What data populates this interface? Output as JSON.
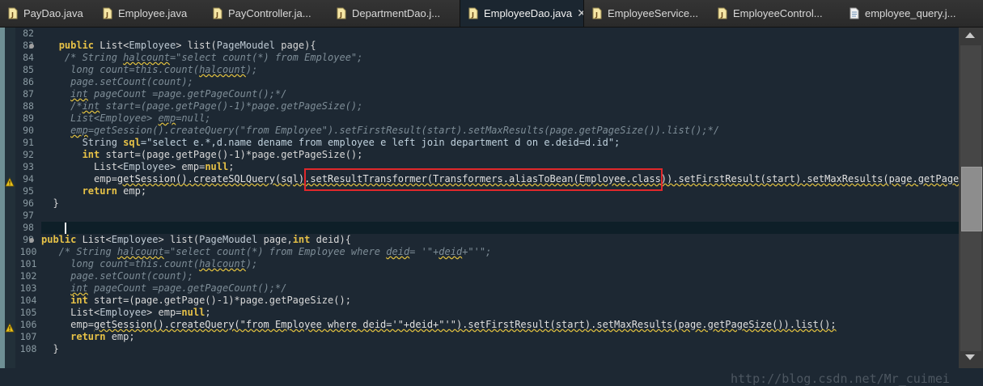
{
  "tabs": [
    {
      "label": "PayDao.java",
      "icon": "java-file-icon",
      "active": false
    },
    {
      "label": "Employee.java",
      "icon": "java-file-icon",
      "active": false
    },
    {
      "label": "PayController.ja...",
      "icon": "java-file-icon",
      "active": false
    },
    {
      "label": "DepartmentDao.j...",
      "icon": "java-file-icon",
      "active": false
    },
    {
      "label": "EmployeeDao.java",
      "icon": "java-file-icon",
      "active": true,
      "close": "✕"
    },
    {
      "label": "EmployeeService...",
      "icon": "java-file-icon",
      "active": false
    },
    {
      "label": "EmployeeControl...",
      "icon": "java-file-icon",
      "active": false
    },
    {
      "label": "employee_query.j...",
      "icon": "jsp-file-icon",
      "active": false
    }
  ],
  "editor": {
    "lines": [
      {
        "n": "82",
        "segs": [
          {
            "t": ""
          }
        ]
      },
      {
        "n": "83",
        "fold": true,
        "segs": [
          {
            "t": "   "
          },
          {
            "t": "public",
            "c": "kw"
          },
          {
            "t": " List<",
            "c": "ty"
          },
          {
            "t": "Employee",
            "c": "ct"
          },
          {
            "t": "> list(",
            "c": "ty"
          },
          {
            "t": "PageMoudel",
            "c": "ct"
          },
          {
            "t": " page){",
            "c": "ty"
          }
        ]
      },
      {
        "n": "84",
        "segs": [
          {
            "t": "    /* String ",
            "c": "cm"
          },
          {
            "t": "halcount",
            "c": "cm wv"
          },
          {
            "t": "=\"select count(*) from Employee\";",
            "c": "cm"
          }
        ]
      },
      {
        "n": "85",
        "segs": [
          {
            "t": "     long count=this.count(",
            "c": "cm"
          },
          {
            "t": "halcount",
            "c": "cm wv"
          },
          {
            "t": ");",
            "c": "cm"
          }
        ]
      },
      {
        "n": "86",
        "segs": [
          {
            "t": "     page.setCount(count);",
            "c": "cm"
          }
        ]
      },
      {
        "n": "87",
        "segs": [
          {
            "t": "     ",
            "c": "cm"
          },
          {
            "t": "int",
            "c": "cm wv"
          },
          {
            "t": " pageCount =page.getPageCount();*/",
            "c": "cm"
          }
        ]
      },
      {
        "n": "88",
        "segs": [
          {
            "t": "     /*",
            "c": "cm"
          },
          {
            "t": "int",
            "c": "cm wv"
          },
          {
            "t": " start=(page.getPage()-1)*page.getPageSize();",
            "c": "cm"
          }
        ]
      },
      {
        "n": "89",
        "segs": [
          {
            "t": "     List<Employee> ",
            "c": "cm"
          },
          {
            "t": "emp",
            "c": "cm wv"
          },
          {
            "t": "=null;",
            "c": "cm"
          }
        ]
      },
      {
        "n": "90",
        "segs": [
          {
            "t": "     ",
            "c": "cm"
          },
          {
            "t": "emp",
            "c": "cm wv"
          },
          {
            "t": "=getSession().createQuery(\"from Employee\").setFirstResult(start).setMaxResults(page.getPageSize()).list();*/",
            "c": "cm"
          }
        ]
      },
      {
        "n": "91",
        "segs": [
          {
            "t": "       "
          },
          {
            "t": "String",
            "c": "ct"
          },
          {
            "t": " "
          },
          {
            "t": "sql",
            "c": "kw"
          },
          {
            "t": "=\"select e.*,d.name dename from employee e left join department d on e.deid=d.id\";",
            "c": "str"
          }
        ]
      },
      {
        "n": "92",
        "segs": [
          {
            "t": "       "
          },
          {
            "t": "int",
            "c": "kw"
          },
          {
            "t": " start=(page.getPage()-1)*page.getPageSize();",
            "c": "ty"
          }
        ]
      },
      {
        "n": "93",
        "segs": [
          {
            "t": "         List<",
            "c": "ty"
          },
          {
            "t": "Employee",
            "c": "ct"
          },
          {
            "t": "> emp=",
            "c": "ty"
          },
          {
            "t": "null",
            "c": "kw"
          },
          {
            "t": ";",
            "c": "ty"
          }
        ]
      },
      {
        "n": "94",
        "warn": true,
        "segs": [
          {
            "t": "         emp=",
            "c": "ty"
          },
          {
            "t": "getSession().createSQLQuery(sql).setResultTransformer(Transformers.aliasToBean(Employee.class)).setFirstResult(start).setMaxResults(page.getPageSize",
            "c": "fn wv"
          }
        ]
      },
      {
        "n": "95",
        "segs": [
          {
            "t": "       "
          },
          {
            "t": "return",
            "c": "kw"
          },
          {
            "t": " emp;",
            "c": "ty"
          }
        ]
      },
      {
        "n": "96",
        "segs": [
          {
            "t": "  }",
            "c": "ty"
          }
        ]
      },
      {
        "n": "97",
        "segs": [
          {
            "t": ""
          }
        ]
      },
      {
        "n": "98",
        "segs": [
          {
            "t": ""
          }
        ]
      },
      {
        "n": "99",
        "fold": true,
        "segs": [
          {
            "t": "public",
            "c": "kw"
          },
          {
            "t": " List<",
            "c": "ty"
          },
          {
            "t": "Employee",
            "c": "ct"
          },
          {
            "t": "> list(",
            "c": "ty"
          },
          {
            "t": "PageMoudel",
            "c": "ct"
          },
          {
            "t": " page,",
            "c": "ty"
          },
          {
            "t": "int",
            "c": "kw"
          },
          {
            "t": " deid){",
            "c": "ty"
          }
        ]
      },
      {
        "n": "100",
        "segs": [
          {
            "t": "   /* String ",
            "c": "cm"
          },
          {
            "t": "halcount",
            "c": "cm wv"
          },
          {
            "t": "=\"select count(*) from Employee where ",
            "c": "cm"
          },
          {
            "t": "deid",
            "c": "cm wv"
          },
          {
            "t": "= '\"+",
            "c": "cm"
          },
          {
            "t": "deid",
            "c": "cm wv"
          },
          {
            "t": "+\"'\";",
            "c": "cm"
          }
        ]
      },
      {
        "n": "101",
        "segs": [
          {
            "t": "     long count=this.count(",
            "c": "cm"
          },
          {
            "t": "halcount",
            "c": "cm wv"
          },
          {
            "t": ");",
            "c": "cm"
          }
        ]
      },
      {
        "n": "102",
        "segs": [
          {
            "t": "     page.setCount(count);",
            "c": "cm"
          }
        ]
      },
      {
        "n": "103",
        "segs": [
          {
            "t": "     ",
            "c": "cm"
          },
          {
            "t": "int",
            "c": "cm wv"
          },
          {
            "t": " pageCount =page.getPageCount();*/",
            "c": "cm"
          }
        ]
      },
      {
        "n": "104",
        "segs": [
          {
            "t": "     "
          },
          {
            "t": "int",
            "c": "kw"
          },
          {
            "t": " start=(page.getPage()-1)*page.getPageSize();",
            "c": "ty"
          }
        ]
      },
      {
        "n": "105",
        "segs": [
          {
            "t": "     List<",
            "c": "ty"
          },
          {
            "t": "Employee",
            "c": "ct"
          },
          {
            "t": "> emp=",
            "c": "ty"
          },
          {
            "t": "null",
            "c": "kw"
          },
          {
            "t": ";",
            "c": "ty"
          }
        ]
      },
      {
        "n": "106",
        "warn": true,
        "segs": [
          {
            "t": "     emp=",
            "c": "ty"
          },
          {
            "t": "getSession().createQuery(\"from Employee where deid='\"+deid+\"'\").setFirstResult(start).setMaxResults(page.getPageSize()).list();",
            "c": "fn wv"
          }
        ]
      },
      {
        "n": "107",
        "segs": [
          {
            "t": "     "
          },
          {
            "t": "return",
            "c": "kw"
          },
          {
            "t": " emp;",
            "c": "ty"
          }
        ]
      },
      {
        "n": "108",
        "segs": [
          {
            "t": "  }",
            "c": "ty"
          }
        ]
      }
    ]
  },
  "watermark": "http://blog.csdn.net/Mr_cuimei"
}
